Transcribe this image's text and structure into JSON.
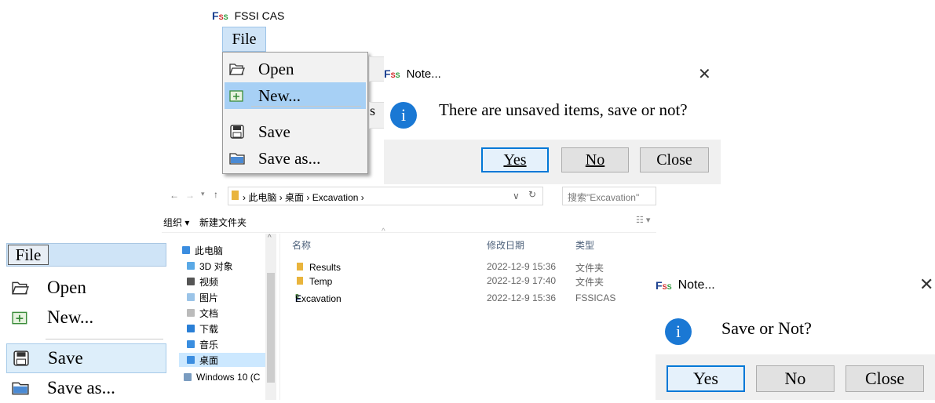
{
  "panel1": {
    "app_title": "FSSI CAS",
    "file_menu": "File",
    "menu_items": [
      {
        "label": "Open",
        "icon": "open-folder-icon"
      },
      {
        "label": "New...",
        "icon": "new-project-icon"
      },
      {
        "label": "Save",
        "icon": "floppy-disk-icon"
      },
      {
        "label": "Save as...",
        "icon": "save-as-folder-icon"
      }
    ],
    "behind_text": "s"
  },
  "dialog1": {
    "title": "Note...",
    "message": "There are unsaved items, save or not?",
    "yes": "Yes",
    "no": "No",
    "close": "Close"
  },
  "explorer": {
    "breadcrumb": [
      "此电脑",
      "桌面",
      "Excavation"
    ],
    "search_placeholder": "搜索\"Excavation\"",
    "toolbar": {
      "organize": "组织 ▾",
      "new_folder": "新建文件夹"
    },
    "nav_items": [
      "此电脑",
      "3D 对象",
      "视频",
      "图片",
      "文档",
      "下载",
      "音乐",
      "桌面",
      "Windows 10 (C"
    ],
    "columns": {
      "name": "名称",
      "date": "修改日期",
      "type": "类型"
    },
    "files": [
      {
        "name": "Results",
        "date": "2022-12-9 15:36",
        "type": "文件夹"
      },
      {
        "name": "Temp",
        "date": "2022-12-9 17:40",
        "type": "文件夹"
      },
      {
        "name": "Excavation",
        "date": "2022-12-9 15:36",
        "type": "FSSICAS"
      }
    ]
  },
  "panel3": {
    "file_menu": "File",
    "menu_items": [
      {
        "label": "Open"
      },
      {
        "label": "New..."
      },
      {
        "label": "Save"
      },
      {
        "label": "Save as..."
      }
    ]
  },
  "dialog2": {
    "title": "Note...",
    "message": "Save or Not?",
    "yes": "Yes",
    "no": "No",
    "close": "Close"
  },
  "colors": {
    "accent": "#0078d7",
    "menu_highlight": "#a7d0f5",
    "info_icon": "#1a78d4"
  }
}
